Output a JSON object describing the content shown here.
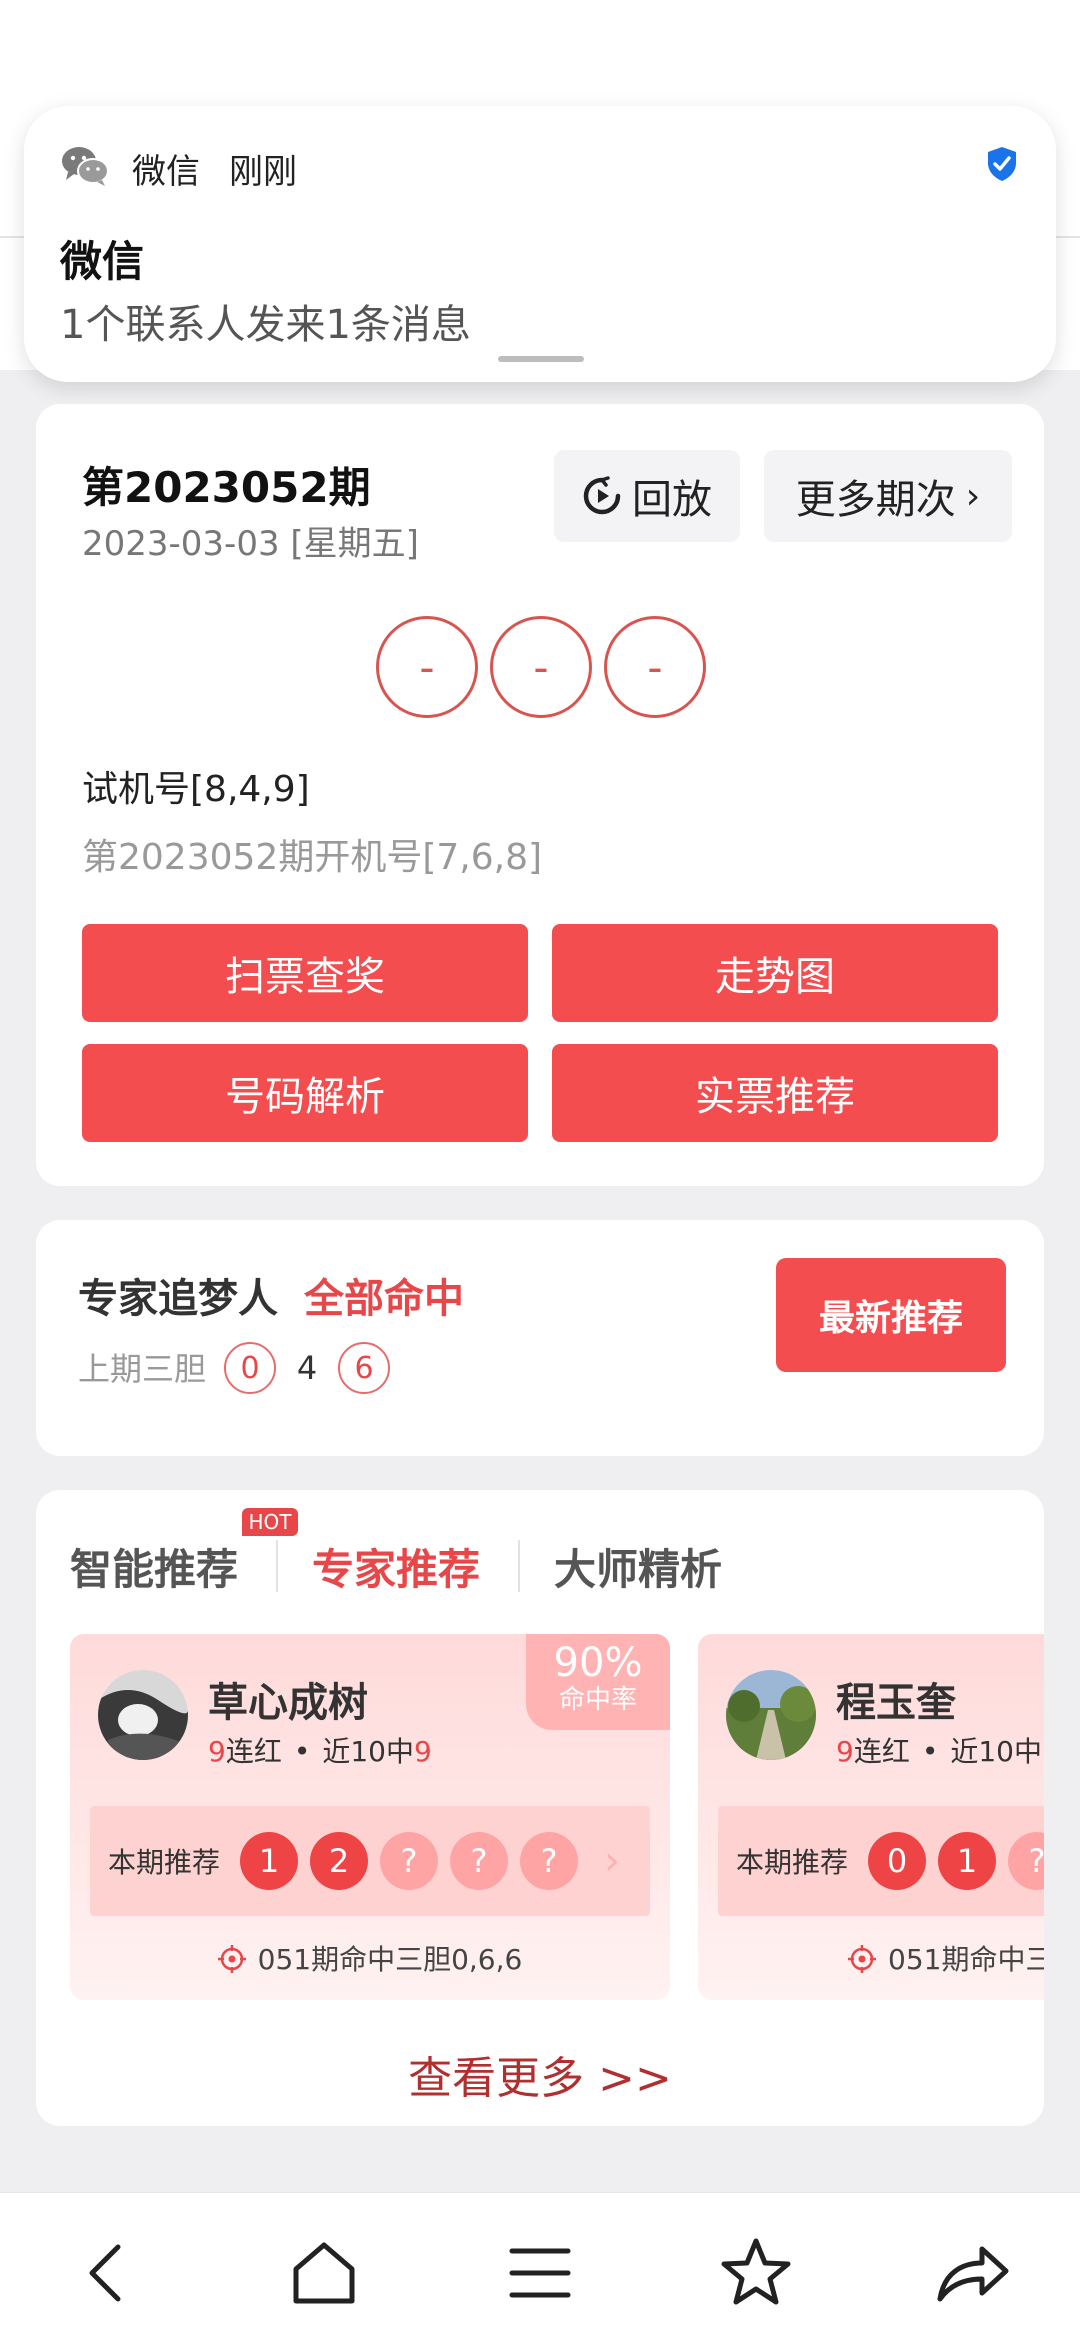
{
  "notification": {
    "app_name": "微信",
    "time": "刚刚",
    "title": "微信",
    "message": "1个联系人发来1条消息"
  },
  "draw": {
    "issue": "第2023052期",
    "date": "2023-03-03 [星期五]",
    "replay_label": "回放",
    "more_label": "更多期次",
    "balls": [
      "-",
      "-",
      "-"
    ],
    "trial": "试机号[8,4,9]",
    "opened": "第2023052期开机号[7,6,8]",
    "buttons": [
      "扫票查奖",
      "走势图",
      "号码解析",
      "实票推荐"
    ]
  },
  "expert_banner": {
    "name": "专家追梦人",
    "result": "全部命中",
    "label": "上期三胆",
    "numbers": [
      "0",
      "4",
      "6"
    ],
    "button": "最新推荐"
  },
  "recommend": {
    "tabs": [
      "智能推荐",
      "专家推荐",
      "大师精析"
    ],
    "hot_badge": "HOT",
    "experts": [
      {
        "name": "草心成树",
        "streak_num": "9",
        "streak_label": "连红",
        "recent_label": "近10中",
        "recent_num": "9",
        "rate": "90%",
        "rate_label": "命中率",
        "pick_label": "本期推荐",
        "picks": [
          "1",
          "2",
          "?",
          "?",
          "?"
        ],
        "hit": "051期命中三胆0,6,6"
      },
      {
        "name": "程玉奎",
        "streak_num": "9",
        "streak_label": "连红",
        "recent_label": "近10中",
        "recent_num": "",
        "pick_label": "本期推荐",
        "picks": [
          "0",
          "1",
          "?"
        ],
        "hit": "051期命中三"
      }
    ],
    "view_more": "查看更多 >>"
  },
  "colors": {
    "accent_red": "#f44d4f",
    "ball_red": "#d9544f",
    "tab_active": "#e8474a",
    "background": "#efeff1"
  },
  "icons": [
    "wechat-icon",
    "shield-check-icon",
    "replay-icon",
    "chevron-right-icon",
    "target-icon",
    "back-icon",
    "home-icon",
    "menu-icon",
    "star-icon",
    "share-icon"
  ]
}
